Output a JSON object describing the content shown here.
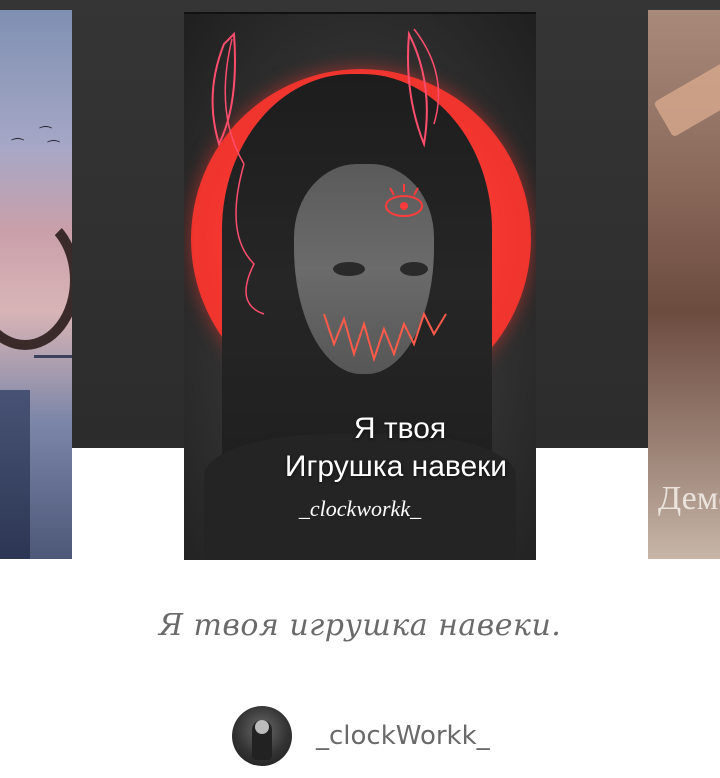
{
  "carousel": {
    "left_cover": {},
    "main_cover": {
      "title_line1": "Я твоя",
      "title_line2": "Игрушка навеки",
      "author_tag": "_clockworkk_"
    },
    "right_cover": {
      "visible_text": "Демс"
    }
  },
  "book": {
    "title": "Я твоя игрушка навеки.",
    "author": "_clockWorkk_"
  },
  "colors": {
    "moon_red": "#f3362f",
    "text_gray": "#6a6a6a",
    "background": "#ffffff"
  }
}
